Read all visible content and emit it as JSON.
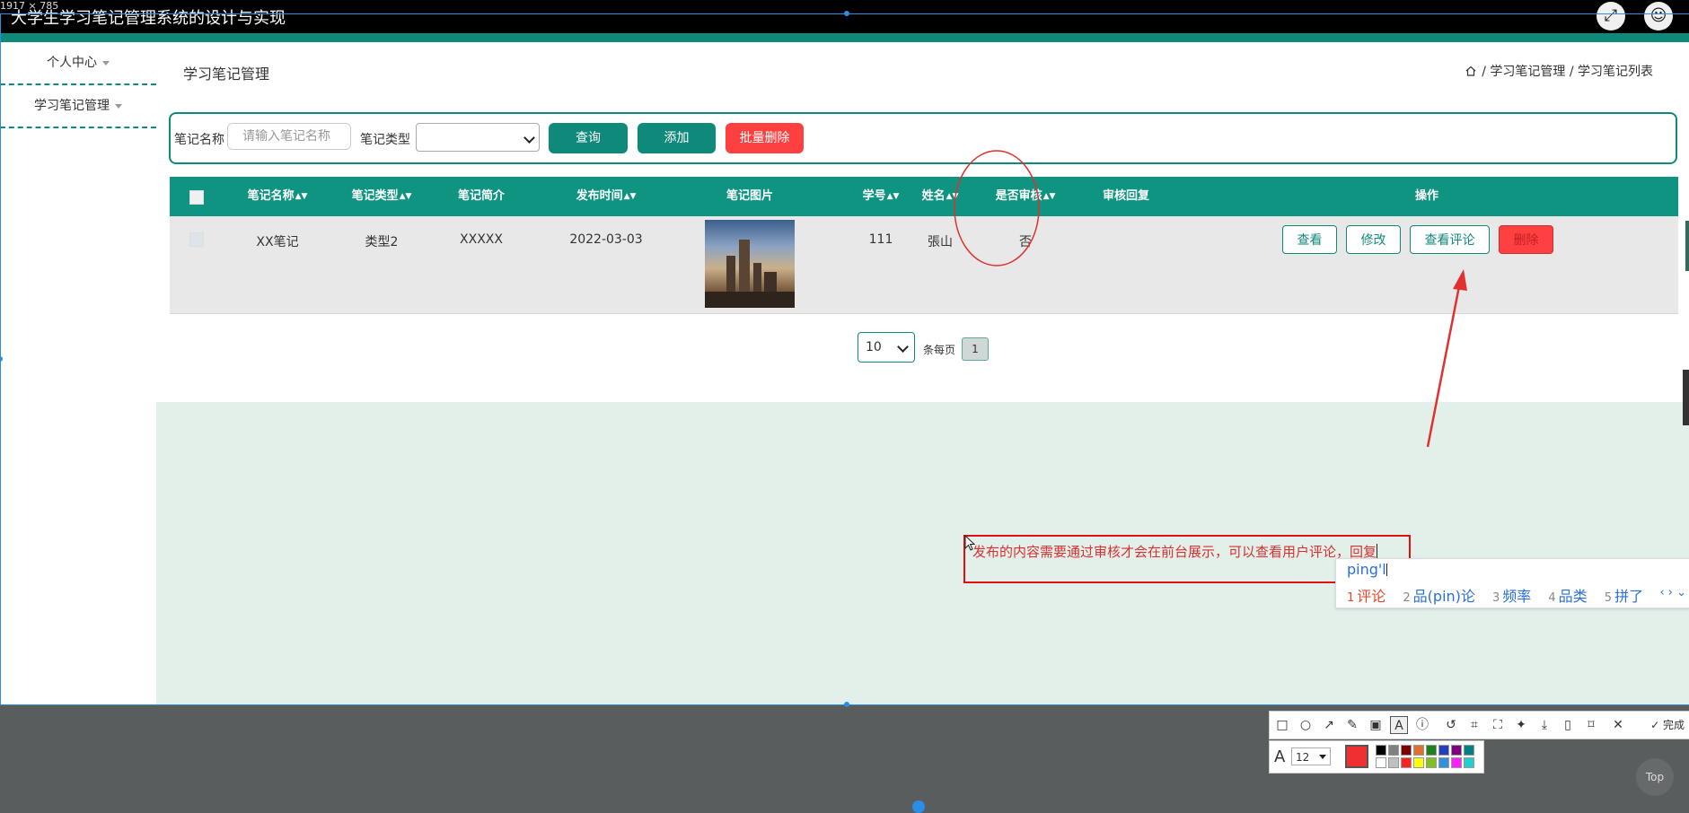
{
  "screen": {
    "dimension_readout": "1917 × 785",
    "app_title": "大学生学习笔记管理系统的设计与实现",
    "fullscreen_icon": "expand-icon",
    "user_icon": "user-icon"
  },
  "sidebar": {
    "items": [
      {
        "label": "个人中心"
      },
      {
        "label": "学习笔记管理"
      }
    ]
  },
  "header": {
    "page_title": "学习笔记管理",
    "breadcrumb": [
      "学习笔记管理",
      "学习笔记列表"
    ],
    "breadcrumb_sep": "/"
  },
  "search": {
    "name_label": "笔记名称",
    "name_placeholder": "请输入笔记名称",
    "type_label": "笔记类型",
    "type_value": "",
    "query_label": "查询",
    "add_label": "添加",
    "batch_delete_label": "批量删除"
  },
  "table": {
    "columns": [
      "笔记名称",
      "笔记类型",
      "笔记简介",
      "发布时间",
      "笔记图片",
      "学号",
      "姓名",
      "是否审核",
      "审核回复",
      "操作"
    ],
    "rows": [
      {
        "name": "XX笔记",
        "type": "类型2",
        "intro": "XXXXX",
        "date": "2022-03-03",
        "student_id": "111",
        "student_name": "張山",
        "reviewed": "否",
        "review_reply": "",
        "actions": [
          "查看",
          "修改",
          "查看评论",
          "删除"
        ]
      }
    ]
  },
  "pagination": {
    "page_size": "10",
    "per_page_label": "条每页",
    "current_page": "1"
  },
  "annotation": {
    "text": "发布的内容需要通过审核才会在前台展示，可以查看用户评论，回复"
  },
  "ime": {
    "input": "ping'l",
    "candidates": [
      {
        "n": "1",
        "text": "评论"
      },
      {
        "n": "2",
        "text": "品(pin)论"
      },
      {
        "n": "3",
        "text": "频率"
      },
      {
        "n": "4",
        "text": "品类"
      },
      {
        "n": "5",
        "text": "拼了"
      }
    ],
    "nav": "‹ › ⌄"
  },
  "capture_toolbar": {
    "finish_label": "完成",
    "font_size": "12",
    "current_color": "#f03030",
    "palette": [
      "#000000",
      "#808080",
      "#800000",
      "#e07030",
      "#208020",
      "#2040c0",
      "#800080",
      "#008080",
      "#ffffff",
      "#c0c0c0",
      "#ff2020",
      "#ffff00",
      "#80c020",
      "#3090e0",
      "#ff20ff",
      "#20d0d0"
    ]
  },
  "top_button": "Top",
  "colors": {
    "accent": "#0f8a7a",
    "danger": "#ff4040",
    "annotation_red": "#e01010"
  }
}
